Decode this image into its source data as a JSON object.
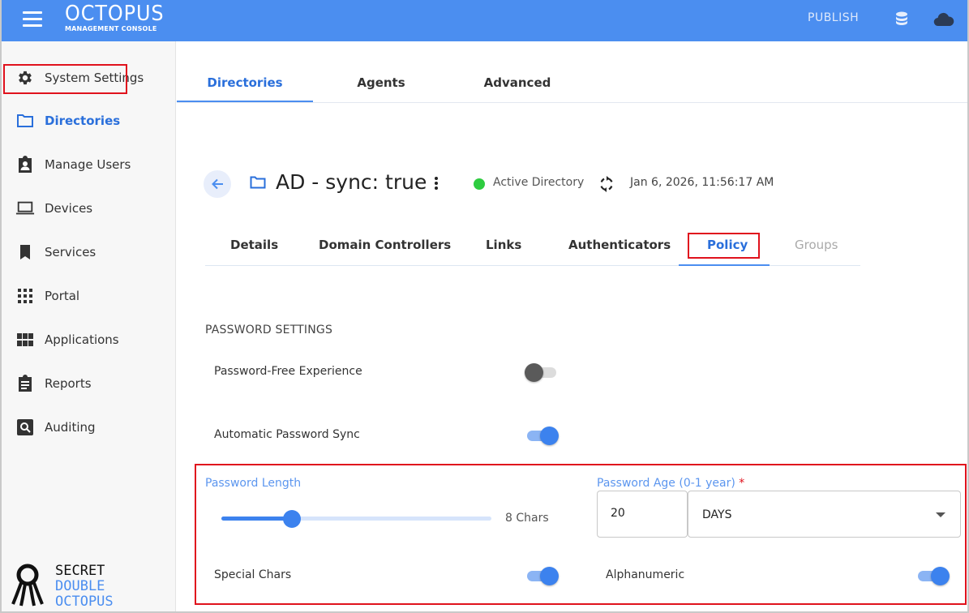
{
  "topbar": {
    "brand_title": "OCTOPUS",
    "brand_subtitle": "MANAGEMENT CONSOLE",
    "publish_label": "PUBLISH",
    "bar_color": "#4b8ef0"
  },
  "sidebar": {
    "items": [
      {
        "label": "System Settings",
        "icon": "gear-icon"
      },
      {
        "label": "Directories",
        "icon": "folder-icon",
        "active": true
      },
      {
        "label": "Manage Users",
        "icon": "user-badge-icon"
      },
      {
        "label": "Devices",
        "icon": "laptop-icon"
      },
      {
        "label": "Services",
        "icon": "bookmark-icon"
      },
      {
        "label": "Portal",
        "icon": "grid-icon"
      },
      {
        "label": "Applications",
        "icon": "apps-icon"
      },
      {
        "label": "Reports",
        "icon": "clipboard-icon"
      },
      {
        "label": "Auditing",
        "icon": "search-icon"
      }
    ],
    "logo": {
      "line1": "SECRET",
      "line2": "DOUBLE",
      "line3": "OCTOPUS"
    }
  },
  "main": {
    "top_tabs": [
      {
        "label": "Directories",
        "active": true
      },
      {
        "label": "Agents"
      },
      {
        "label": "Advanced"
      }
    ],
    "directory": {
      "title": "AD - sync: true",
      "status": "Active Directory",
      "status_color": "#2ecc40",
      "timestamp": "Jan 6, 2026, 11:56:17 AM"
    },
    "sub_tabs": [
      {
        "label": "Details"
      },
      {
        "label": "Domain Controllers"
      },
      {
        "label": "Links"
      },
      {
        "label": "Authenticators"
      },
      {
        "label": "Policy",
        "active": true
      },
      {
        "label": "Groups",
        "disabled": true
      }
    ],
    "password_settings": {
      "section_title": "PASSWORD SETTINGS",
      "password_free": {
        "label": "Password-Free Experience",
        "enabled": false
      },
      "auto_sync": {
        "label": "Automatic Password Sync",
        "enabled": true
      },
      "length": {
        "label": "Password Length",
        "value_text": "8 Chars",
        "slider_fraction": 0.26
      },
      "age": {
        "label": "Password Age (0-1 year)",
        "required_mark": "*",
        "value": "20",
        "unit": "DAYS"
      },
      "special_chars": {
        "label": "Special Chars",
        "enabled": true
      },
      "alphanumeric": {
        "label": "Alphanumeric",
        "enabled": true
      }
    }
  }
}
